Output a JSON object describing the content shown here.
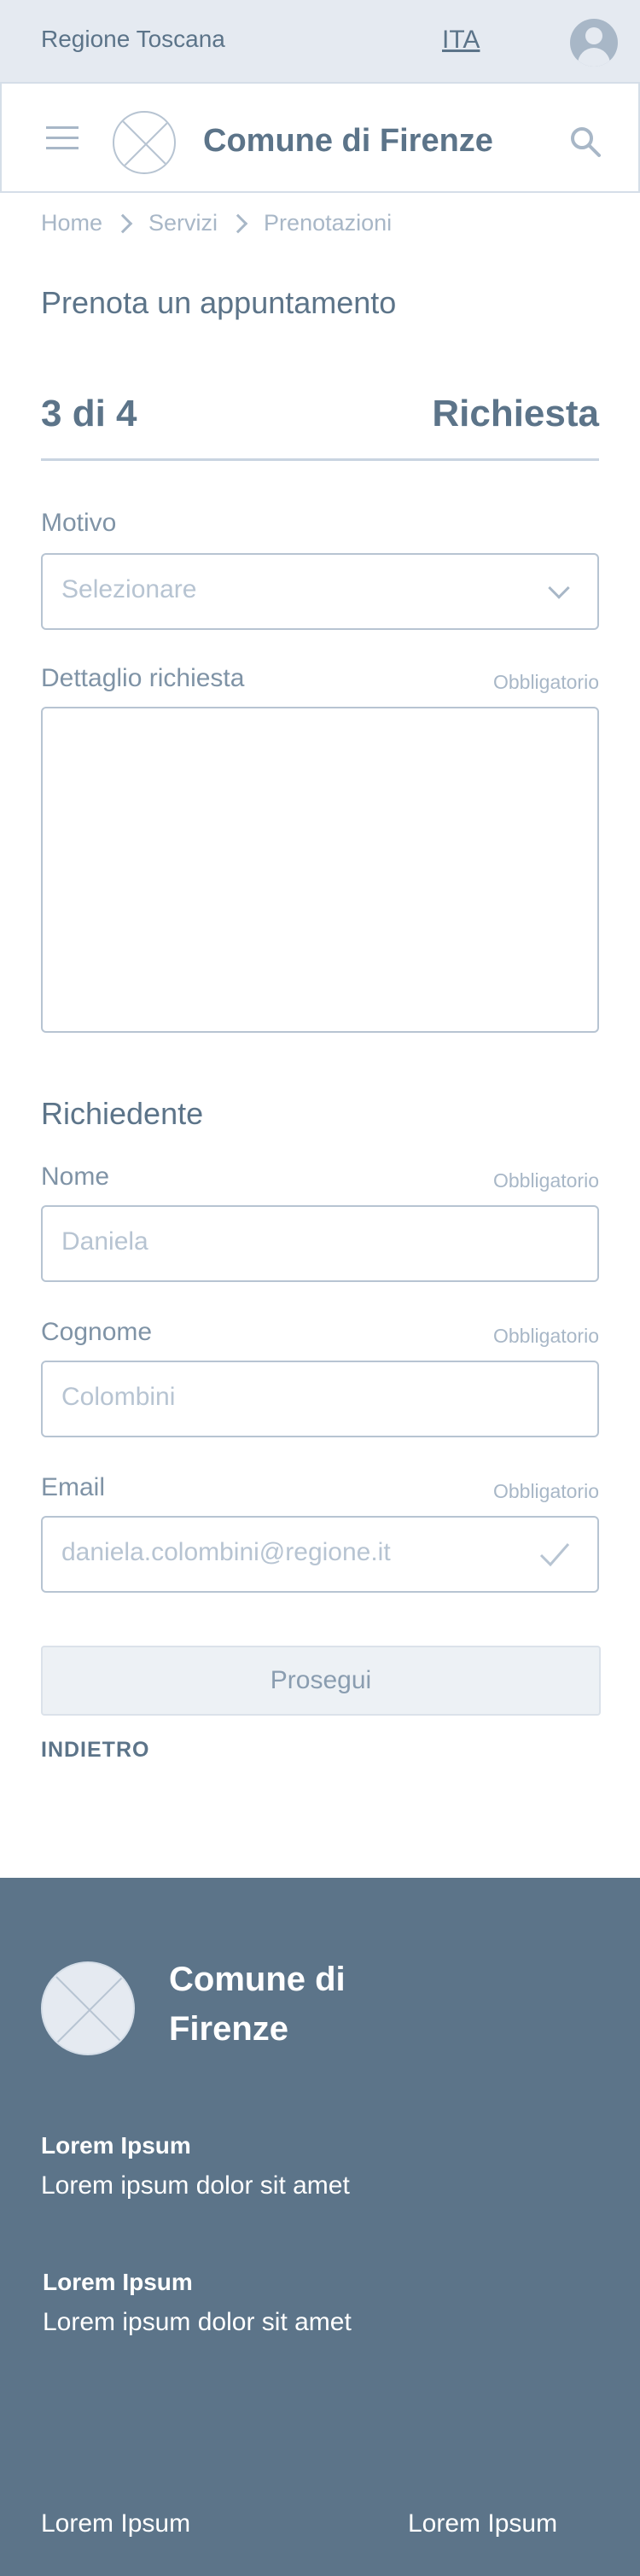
{
  "topbar": {
    "region": "Regione Toscana",
    "language": "ITA"
  },
  "header": {
    "title": "Comune di Firenze"
  },
  "breadcrumb": [
    "Home",
    "Servizi",
    "Prenotazioni"
  ],
  "page": {
    "title": "Prenota un appuntamento"
  },
  "step": {
    "counter": "3 di 4",
    "name": "Richiesta"
  },
  "form": {
    "motivo": {
      "label": "Motivo",
      "placeholder": "Selezionare"
    },
    "dettaglio": {
      "label": "Dettaglio richiesta",
      "required": "Obbligatorio",
      "value": ""
    },
    "section_title": "Richiedente",
    "nome": {
      "label": "Nome",
      "required": "Obbligatorio",
      "value": "Daniela"
    },
    "cognome": {
      "label": "Cognome",
      "required": "Obbligatorio",
      "value": "Colombini"
    },
    "email": {
      "label": "Email",
      "required": "Obbligatorio",
      "value": "daniela.colombini@regione.it"
    }
  },
  "actions": {
    "next": "Prosegui",
    "back": "INDIETRO"
  },
  "footer": {
    "name": "Comune di Firenze",
    "groups": [
      {
        "title": "Lorem Ipsum",
        "text": "Lorem ipsum dolor sit amet"
      },
      {
        "title": "Lorem Ipsum",
        "text": "Lorem ipsum dolor sit amet"
      }
    ],
    "links": [
      "Lorem Ipsum",
      "Lorem Ipsum"
    ]
  },
  "colors": {
    "primary": "#5c7489",
    "muted": "#a8b7c7",
    "border": "#b7c4d2",
    "topbar_bg": "#e5eaf1"
  }
}
